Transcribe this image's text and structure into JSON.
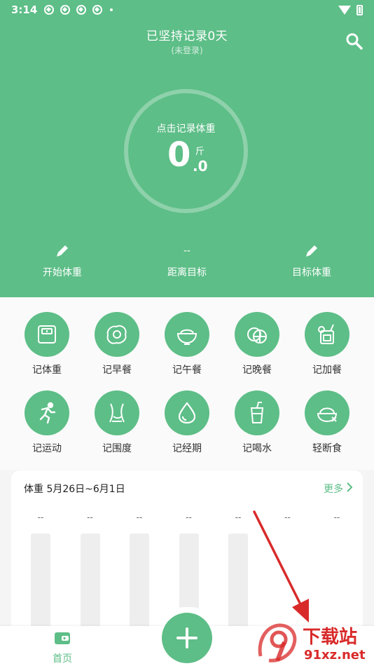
{
  "status_bar": {
    "time": "3:14"
  },
  "header": {
    "title": "已坚持记录0天",
    "subtitle": "(未登录)",
    "circle_label": "点击记录体重",
    "weight_int": "0",
    "weight_dec": ".0",
    "unit": "斤"
  },
  "stats": {
    "start": {
      "label": "开始体重"
    },
    "distance": {
      "value": "--",
      "label": "距离目标"
    },
    "target": {
      "label": "目标体重"
    }
  },
  "actions": [
    {
      "label": "记体重",
      "icon": "scale-icon"
    },
    {
      "label": "记早餐",
      "icon": "fried-egg-icon"
    },
    {
      "label": "记午餐",
      "icon": "rice-bowl-icon"
    },
    {
      "label": "记晚餐",
      "icon": "lemon-icon"
    },
    {
      "label": "记加餐",
      "icon": "drink-icon"
    },
    {
      "label": "记运动",
      "icon": "running-icon"
    },
    {
      "label": "记围度",
      "icon": "waist-icon"
    },
    {
      "label": "记经期",
      "icon": "drop-icon"
    },
    {
      "label": "记喝水",
      "icon": "cup-icon"
    },
    {
      "label": "轻断食",
      "icon": "fasting-bowl-icon"
    }
  ],
  "chart_card": {
    "title": "体重 5月26日~6月1日",
    "more": "更多"
  },
  "chart_data": {
    "type": "bar",
    "title": "体重 5月26日~6月1日",
    "categories": [],
    "values": [
      "--",
      "--",
      "--",
      "--",
      "--",
      "--",
      "--"
    ],
    "xlabel": "",
    "ylabel": ""
  },
  "bottom_nav": {
    "home_label": "首页"
  },
  "watermark": {
    "big": "下载站",
    "small": "91xz.net"
  },
  "colors": {
    "accent": "#5dbe87",
    "arrow": "#d92a2a"
  }
}
